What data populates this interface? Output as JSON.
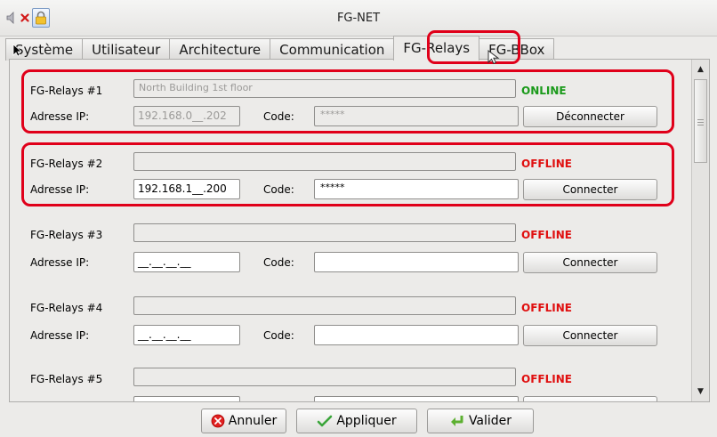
{
  "window": {
    "title": "FG-NET"
  },
  "tabs": [
    {
      "label": "Système"
    },
    {
      "label": "Utilisateur"
    },
    {
      "label": "Architecture"
    },
    {
      "label": "Communication"
    },
    {
      "label": "FG-Relays",
      "active": true
    },
    {
      "label": "FG-BBox"
    }
  ],
  "labels": {
    "ip": "Adresse IP:",
    "code": "Code:"
  },
  "relays": [
    {
      "title": "FG-Relays #1",
      "name": "North Building 1st floor",
      "status": "ONLINE",
      "ip": "192.168.0__.202",
      "code": "*****",
      "action": "Déconnecter",
      "enabled": false
    },
    {
      "title": "FG-Relays #2",
      "name": "",
      "status": "OFFLINE",
      "ip": "192.168.1__.200",
      "code": "*****",
      "action": "Connecter",
      "enabled": true
    },
    {
      "title": "FG-Relays #3",
      "name": "",
      "status": "OFFLINE",
      "ip": "__.__.__.__",
      "code": "",
      "action": "Connecter",
      "enabled": true
    },
    {
      "title": "FG-Relays #4",
      "name": "",
      "status": "OFFLINE",
      "ip": "__.__.__.__",
      "code": "",
      "action": "Connecter",
      "enabled": true
    },
    {
      "title": "FG-Relays #5",
      "name": "",
      "status": "OFFLINE",
      "ip": "",
      "code": "",
      "action": "",
      "enabled": true
    }
  ],
  "colors": {
    "online": "#1a9a1a",
    "offline": "#e01010",
    "highlight": "#e0001a"
  },
  "footer": {
    "cancel": "Annuler",
    "apply": "Appliquer",
    "ok": "Valider"
  },
  "icons": {
    "volume": "speaker-mute-icon",
    "close": "close-x-icon",
    "lock": "padlock-icon",
    "cancel": "red-circle-x-icon",
    "apply": "green-check-icon",
    "ok": "green-enter-arrow-icon"
  }
}
